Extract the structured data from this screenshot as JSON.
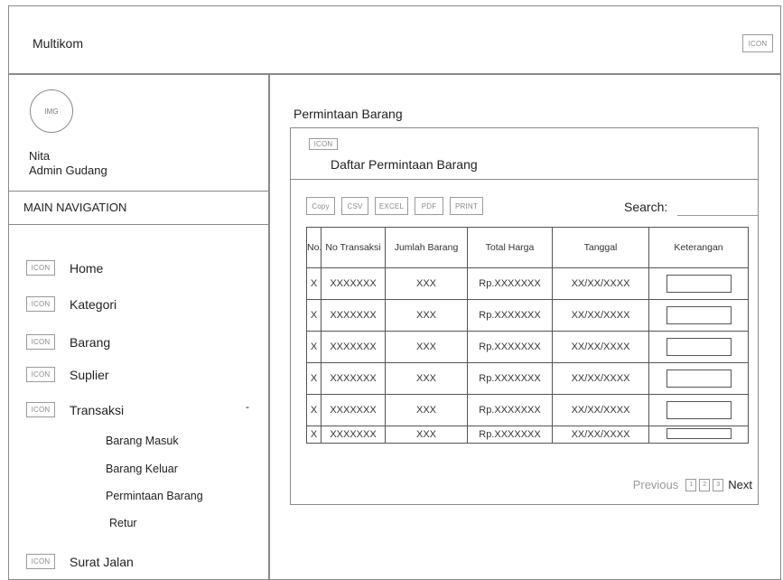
{
  "header": {
    "app_title": "Multikom",
    "icon_label": "ICON"
  },
  "sidebar": {
    "avatar_label": "IMG",
    "user_name": "Nita",
    "user_role": "Admin Gudang",
    "nav_header": "MAIN NAVIGATION",
    "icon_label": "ICON",
    "items": [
      {
        "label": "Home"
      },
      {
        "label": "Kategori"
      },
      {
        "label": "Barang"
      },
      {
        "label": "Suplier"
      },
      {
        "label": "Transaksi",
        "caret": "-"
      },
      {
        "label": "Surat Jalan"
      }
    ],
    "sub_items": [
      {
        "label": "Barang Masuk"
      },
      {
        "label": "Barang Keluar"
      },
      {
        "label": "Permintaan Barang"
      },
      {
        "label": "Retur"
      }
    ]
  },
  "main": {
    "page_title": "Permintaan Barang",
    "panel": {
      "icon_label": "ICON",
      "title": "Daftar Permintaan Barang",
      "toolbar": {
        "copy": "Copy",
        "csv": "CSV",
        "excel": "EXCEL",
        "pdf": "PDF",
        "print": "PRINT"
      },
      "search_label": "Search:",
      "search_value": ""
    },
    "table": {
      "columns": [
        "No.",
        "No Transaksi",
        "Jumlah Barang",
        "Total Harga",
        "Tanggal",
        "Keterangan"
      ],
      "rows": [
        [
          "X",
          "XXXXXXX",
          "XXX",
          "Rp.XXXXXXX",
          "XX/XX/XXXX"
        ],
        [
          "X",
          "XXXXXXX",
          "XXX",
          "Rp.XXXXXXX",
          "XX/XX/XXXX"
        ],
        [
          "X",
          "XXXXXXX",
          "XXX",
          "Rp.XXXXXXX",
          "XX/XX/XXXX"
        ],
        [
          "X",
          "XXXXXXX",
          "XXX",
          "Rp.XXXXXXX",
          "XX/XX/XXXX"
        ],
        [
          "X",
          "XXXXXXX",
          "XXX",
          "Rp.XXXXXXX",
          "XX/XX/XXXX"
        ],
        [
          "X",
          "XXXXXXX",
          "XXX",
          "Rp.XXXXXXX",
          "XX/XX/XXXX"
        ]
      ]
    },
    "pagination": {
      "previous": "Previous",
      "pages": [
        "1",
        "2",
        "3"
      ],
      "next": "Next"
    }
  }
}
